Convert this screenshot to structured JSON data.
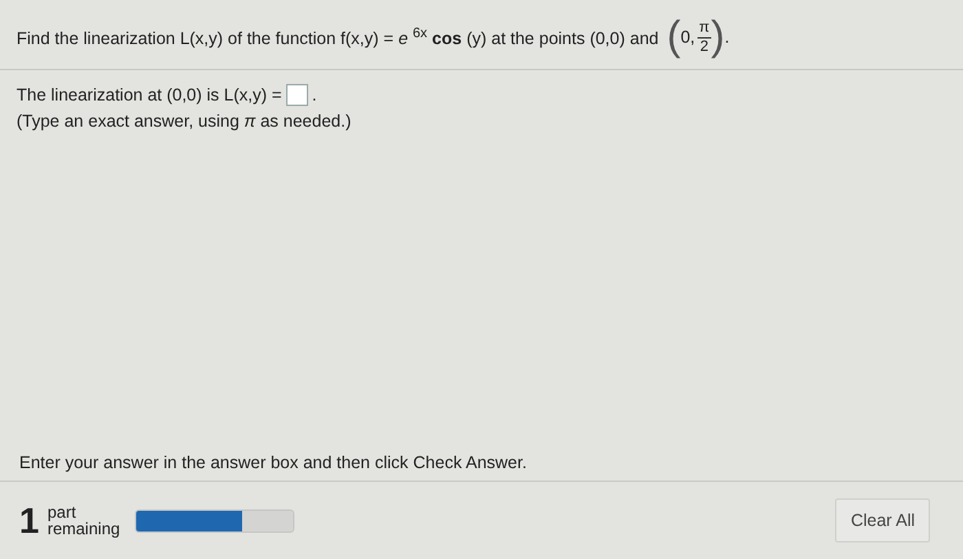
{
  "question": {
    "text": "Find the linearization L(x,y) of the function f(x,y) = *e* $^{6x}$ **cos** (y) at the points (0,0) and",
    "point": {
      "open": "(",
      "first": "0,",
      "close": ")",
      "numerator": "π",
      "denominator": "2",
      "end": "."
    }
  },
  "answer": {
    "prompt": "The linearization at (0,0) is L(x,y) =",
    "end": ".",
    "hint": "(Type an exact answer, using *π* as needed.)"
  },
  "instruction": "Enter your answer in the answer box and then click Check Answer.",
  "footer": {
    "count": "1",
    "label_top": "part",
    "label_bottom": "remaining",
    "progress": {
      "level": 0.67
    },
    "clear_button": "Clear All"
  }
}
